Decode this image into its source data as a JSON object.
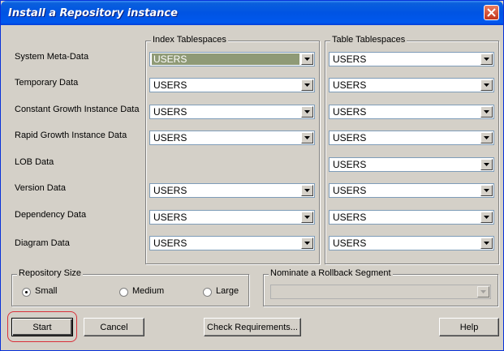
{
  "window": {
    "title": "Install a Repository instance"
  },
  "rows": [
    {
      "label": "System Meta-Data",
      "index": "USERS",
      "table": "USERS"
    },
    {
      "label": "Temporary Data",
      "index": "USERS",
      "table": "USERS"
    },
    {
      "label": "Constant Growth Instance Data",
      "index": "USERS",
      "table": "USERS"
    },
    {
      "label": "Rapid Growth Instance Data",
      "index": "USERS",
      "table": "USERS"
    },
    {
      "label": "LOB Data",
      "table": "USERS"
    },
    {
      "label": "Version Data",
      "index": "USERS",
      "table": "USERS"
    },
    {
      "label": "Dependency Data",
      "index": "USERS",
      "table": "USERS"
    },
    {
      "label": "Diagram Data",
      "index": "USERS",
      "table": "USERS"
    }
  ],
  "groups": {
    "index_title": "Index Tablespaces",
    "table_title": "Table Tablespaces",
    "size_title": "Repository Size",
    "rollback_title": "Nominate a Rollback Segment"
  },
  "size_options": {
    "small": "Small",
    "medium": "Medium",
    "large": "Large",
    "selected": "Small"
  },
  "rollback": {
    "value": ""
  },
  "buttons": {
    "start": "Start",
    "cancel": "Cancel",
    "check": "Check Requirements...",
    "help": "Help"
  }
}
